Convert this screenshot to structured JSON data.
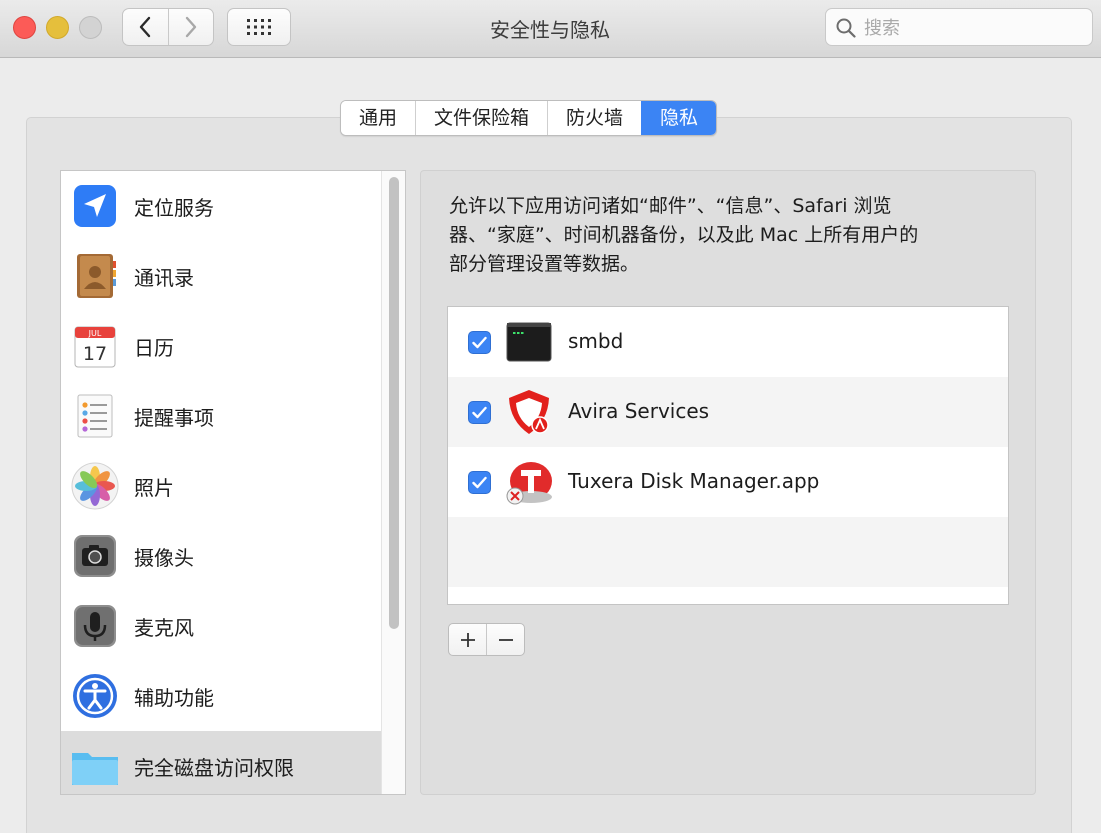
{
  "window": {
    "title": "安全性与隐私"
  },
  "search": {
    "placeholder": "搜索"
  },
  "tabs": [
    {
      "label": "通用",
      "active": false
    },
    {
      "label": "文件保险箱",
      "active": false
    },
    {
      "label": "防火墙",
      "active": false
    },
    {
      "label": "隐私",
      "active": true
    }
  ],
  "sidebar": {
    "items": [
      {
        "label": "定位服务",
        "icon": "location-arrow-icon"
      },
      {
        "label": "通讯录",
        "icon": "contacts-book-icon"
      },
      {
        "label": "日历",
        "icon": "calendar-icon",
        "calendar_month": "JUL",
        "calendar_day": "17"
      },
      {
        "label": "提醒事项",
        "icon": "reminders-icon"
      },
      {
        "label": "照片",
        "icon": "photos-icon"
      },
      {
        "label": "摄像头",
        "icon": "camera-icon"
      },
      {
        "label": "麦克风",
        "icon": "microphone-icon"
      },
      {
        "label": "辅助功能",
        "icon": "accessibility-icon"
      },
      {
        "label": "完全磁盘访问权限",
        "icon": "folder-icon",
        "selected": true
      }
    ]
  },
  "main": {
    "description_line1": "允许以下应用访问诸如“邮件”、“信息”、Safari 浏览",
    "description_line2": "器、“家庭”、时间机器备份，以及此 Mac 上所有用户的",
    "description_line3": "部分管理设置等数据。",
    "apps": [
      {
        "name": "smbd",
        "checked": true,
        "icon": "terminal-icon"
      },
      {
        "name": "Avira Services",
        "checked": true,
        "icon": "avira-shield-icon"
      },
      {
        "name": "Tuxera Disk Manager.app",
        "checked": true,
        "icon": "tuxera-icon"
      }
    ]
  },
  "colors": {
    "accent": "#3b84f4",
    "selected_row": "#dcdcdc",
    "window_bg": "#ececec"
  }
}
